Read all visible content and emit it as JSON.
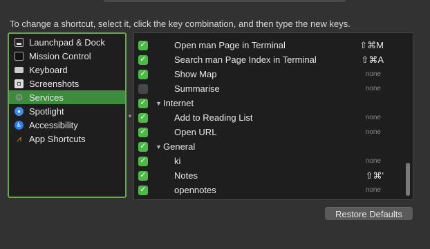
{
  "instruction": "To change a shortcut, select it, click the key combination, and then type the new keys.",
  "categories": [
    {
      "label": "Launchpad & Dock",
      "icon": "launchpad-icon"
    },
    {
      "label": "Mission Control",
      "icon": "mission-control-icon"
    },
    {
      "label": "Keyboard",
      "icon": "keyboard-icon"
    },
    {
      "label": "Screenshots",
      "icon": "screenshot-icon"
    },
    {
      "label": "Services",
      "icon": "gear-icon",
      "selected": true
    },
    {
      "label": "Spotlight",
      "icon": "spotlight-icon"
    },
    {
      "label": "Accessibility",
      "icon": "accessibility-icon"
    },
    {
      "label": "App Shortcuts",
      "icon": "app-shortcuts-icon"
    }
  ],
  "shortcuts": [
    {
      "type": "item",
      "label": "Open man Page in Terminal",
      "checked": true,
      "shortcut": "⇧⌘M"
    },
    {
      "type": "item",
      "label": "Search man Page Index in Terminal",
      "checked": true,
      "shortcut": "⇧⌘A"
    },
    {
      "type": "item",
      "label": "Show Map",
      "checked": true,
      "shortcut": "none"
    },
    {
      "type": "item",
      "label": "Summarise",
      "checked": false,
      "shortcut": "none"
    },
    {
      "type": "group",
      "label": "Internet",
      "checked": true
    },
    {
      "type": "item",
      "label": "Add to Reading List",
      "checked": true,
      "shortcut": "none"
    },
    {
      "type": "item",
      "label": "Open URL",
      "checked": true,
      "shortcut": "none"
    },
    {
      "type": "group",
      "label": "General",
      "checked": true
    },
    {
      "type": "item",
      "label": "ki",
      "checked": true,
      "shortcut": "none"
    },
    {
      "type": "item",
      "label": "Notes",
      "checked": true,
      "shortcut": "⇧⌘'"
    },
    {
      "type": "item",
      "label": "opennotes",
      "checked": true,
      "shortcut": "none"
    }
  ],
  "restore_label": "Restore Defaults",
  "colors": {
    "accent": "#3d8b3d",
    "check": "#4cbb45",
    "focus_ring": "#6aa84f"
  }
}
